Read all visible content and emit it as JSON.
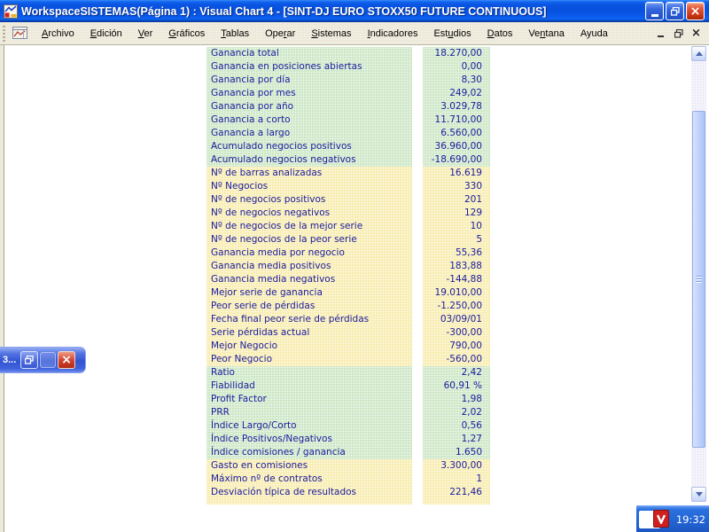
{
  "window": {
    "title": "WorkspaceSISTEMAS(Página 1) : Visual Chart 4 - [SINT-DJ EURO STOXX50 FUTURE CONTINUOUS]"
  },
  "icons": {
    "minimize": "_",
    "restore": "❐",
    "close": "×",
    "app": "visual-chart-logo",
    "tray": "visual-chart-red-logo"
  },
  "menu": {
    "items": [
      {
        "label": "Archivo",
        "accel": 0
      },
      {
        "label": "Edición",
        "accel": 0
      },
      {
        "label": "Ver",
        "accel": 0
      },
      {
        "label": "Gráficos",
        "accel": 0
      },
      {
        "label": "Tablas",
        "accel": 0
      },
      {
        "label": "Operar",
        "accel": 3
      },
      {
        "label": "Sistemas",
        "accel": 0
      },
      {
        "label": "Indicadores",
        "accel": 0
      },
      {
        "label": "Estudios",
        "accel": 3
      },
      {
        "label": "Datos",
        "accel": 0
      },
      {
        "label": "Ventana",
        "accel": 2
      },
      {
        "label": "Ayuda",
        "accel": -1
      }
    ]
  },
  "stats_table": {
    "rows": [
      {
        "label": "Ganancia total",
        "value": "18.270,00",
        "tone": "green"
      },
      {
        "label": "Ganancia en posiciones abiertas",
        "value": "0,00",
        "tone": "green"
      },
      {
        "label": "Ganancia por día",
        "value": "8,30",
        "tone": "green"
      },
      {
        "label": "Ganancia por mes",
        "value": "249,02",
        "tone": "green"
      },
      {
        "label": "Ganancia por año",
        "value": "3.029,78",
        "tone": "green"
      },
      {
        "label": "Ganancia a corto",
        "value": "11.710,00",
        "tone": "green"
      },
      {
        "label": "Ganancia a largo",
        "value": "6.560,00",
        "tone": "green"
      },
      {
        "label": "Acumulado negocios positivos",
        "value": "36.960,00",
        "tone": "green"
      },
      {
        "label": "Acumulado negocios negativos",
        "value": "-18.690,00",
        "tone": "green"
      },
      {
        "label": "Nº de barras analizadas",
        "value": "16.619",
        "tone": "yellow"
      },
      {
        "label": "Nº Negocios",
        "value": "330",
        "tone": "yellow"
      },
      {
        "label": "Nº de negocios positivos",
        "value": "201",
        "tone": "yellow"
      },
      {
        "label": "Nº de negocios negativos",
        "value": "129",
        "tone": "yellow"
      },
      {
        "label": "Nº de negocios de la mejor serie",
        "value": "10",
        "tone": "yellow"
      },
      {
        "label": "Nº de negocios de la peor serie",
        "value": "5",
        "tone": "yellow"
      },
      {
        "label": "Ganancia media por negocio",
        "value": "55,36",
        "tone": "yellow"
      },
      {
        "label": "Ganancia media positivos",
        "value": "183,88",
        "tone": "yellow"
      },
      {
        "label": "Ganancia media negativos",
        "value": "-144,88",
        "tone": "yellow"
      },
      {
        "label": "Mejor serie de ganancia",
        "value": "19.010,00",
        "tone": "yellow"
      },
      {
        "label": "Peor serie de pérdidas",
        "value": "-1.250,00",
        "tone": "yellow"
      },
      {
        "label": "Fecha final peor serie de pérdidas",
        "value": "03/09/01",
        "tone": "yellow"
      },
      {
        "label": "Serie pérdidas actual",
        "value": "-300,00",
        "tone": "yellow"
      },
      {
        "label": "Mejor Negocio",
        "value": "790,00",
        "tone": "yellow"
      },
      {
        "label": "Peor Negocio",
        "value": "-560,00",
        "tone": "yellow"
      },
      {
        "label": "Ratio",
        "value": "2,42",
        "tone": "green"
      },
      {
        "label": "Fiabilidad",
        "value": "60,91 %",
        "tone": "green"
      },
      {
        "label": "Profit Factor",
        "value": "1,98",
        "tone": "green"
      },
      {
        "label": "PRR",
        "value": "2,02",
        "tone": "green"
      },
      {
        "label": "Índice Largo/Corto",
        "value": "0,56",
        "tone": "green"
      },
      {
        "label": "Índice Positivos/Negativos",
        "value": "1,27",
        "tone": "green"
      },
      {
        "label": "Índice comisiones / ganancia",
        "value": "1.650",
        "tone": "green"
      },
      {
        "label": "Gasto en comisiones",
        "value": "3.300,00",
        "tone": "yellow"
      },
      {
        "label": "Máximo nº de contratos",
        "value": "1",
        "tone": "yellow"
      },
      {
        "label": "Desviación típica de resultados",
        "value": "221,46",
        "tone": "yellow"
      },
      {
        "label": "",
        "value": "",
        "tone": "yellow"
      }
    ]
  },
  "minimized_window": {
    "title_fragment": "3..."
  },
  "taskbar": {
    "clock": "19:32"
  },
  "colors": {
    "titlebar_blue": "#0850de",
    "menu_bg": "#eeeadb",
    "row_green": "#cfe8c8",
    "row_yellow": "#f8edb2",
    "text_navy": "#1b1b9e",
    "close_red": "#d44432",
    "taskbar_blue": "#2263d3"
  }
}
